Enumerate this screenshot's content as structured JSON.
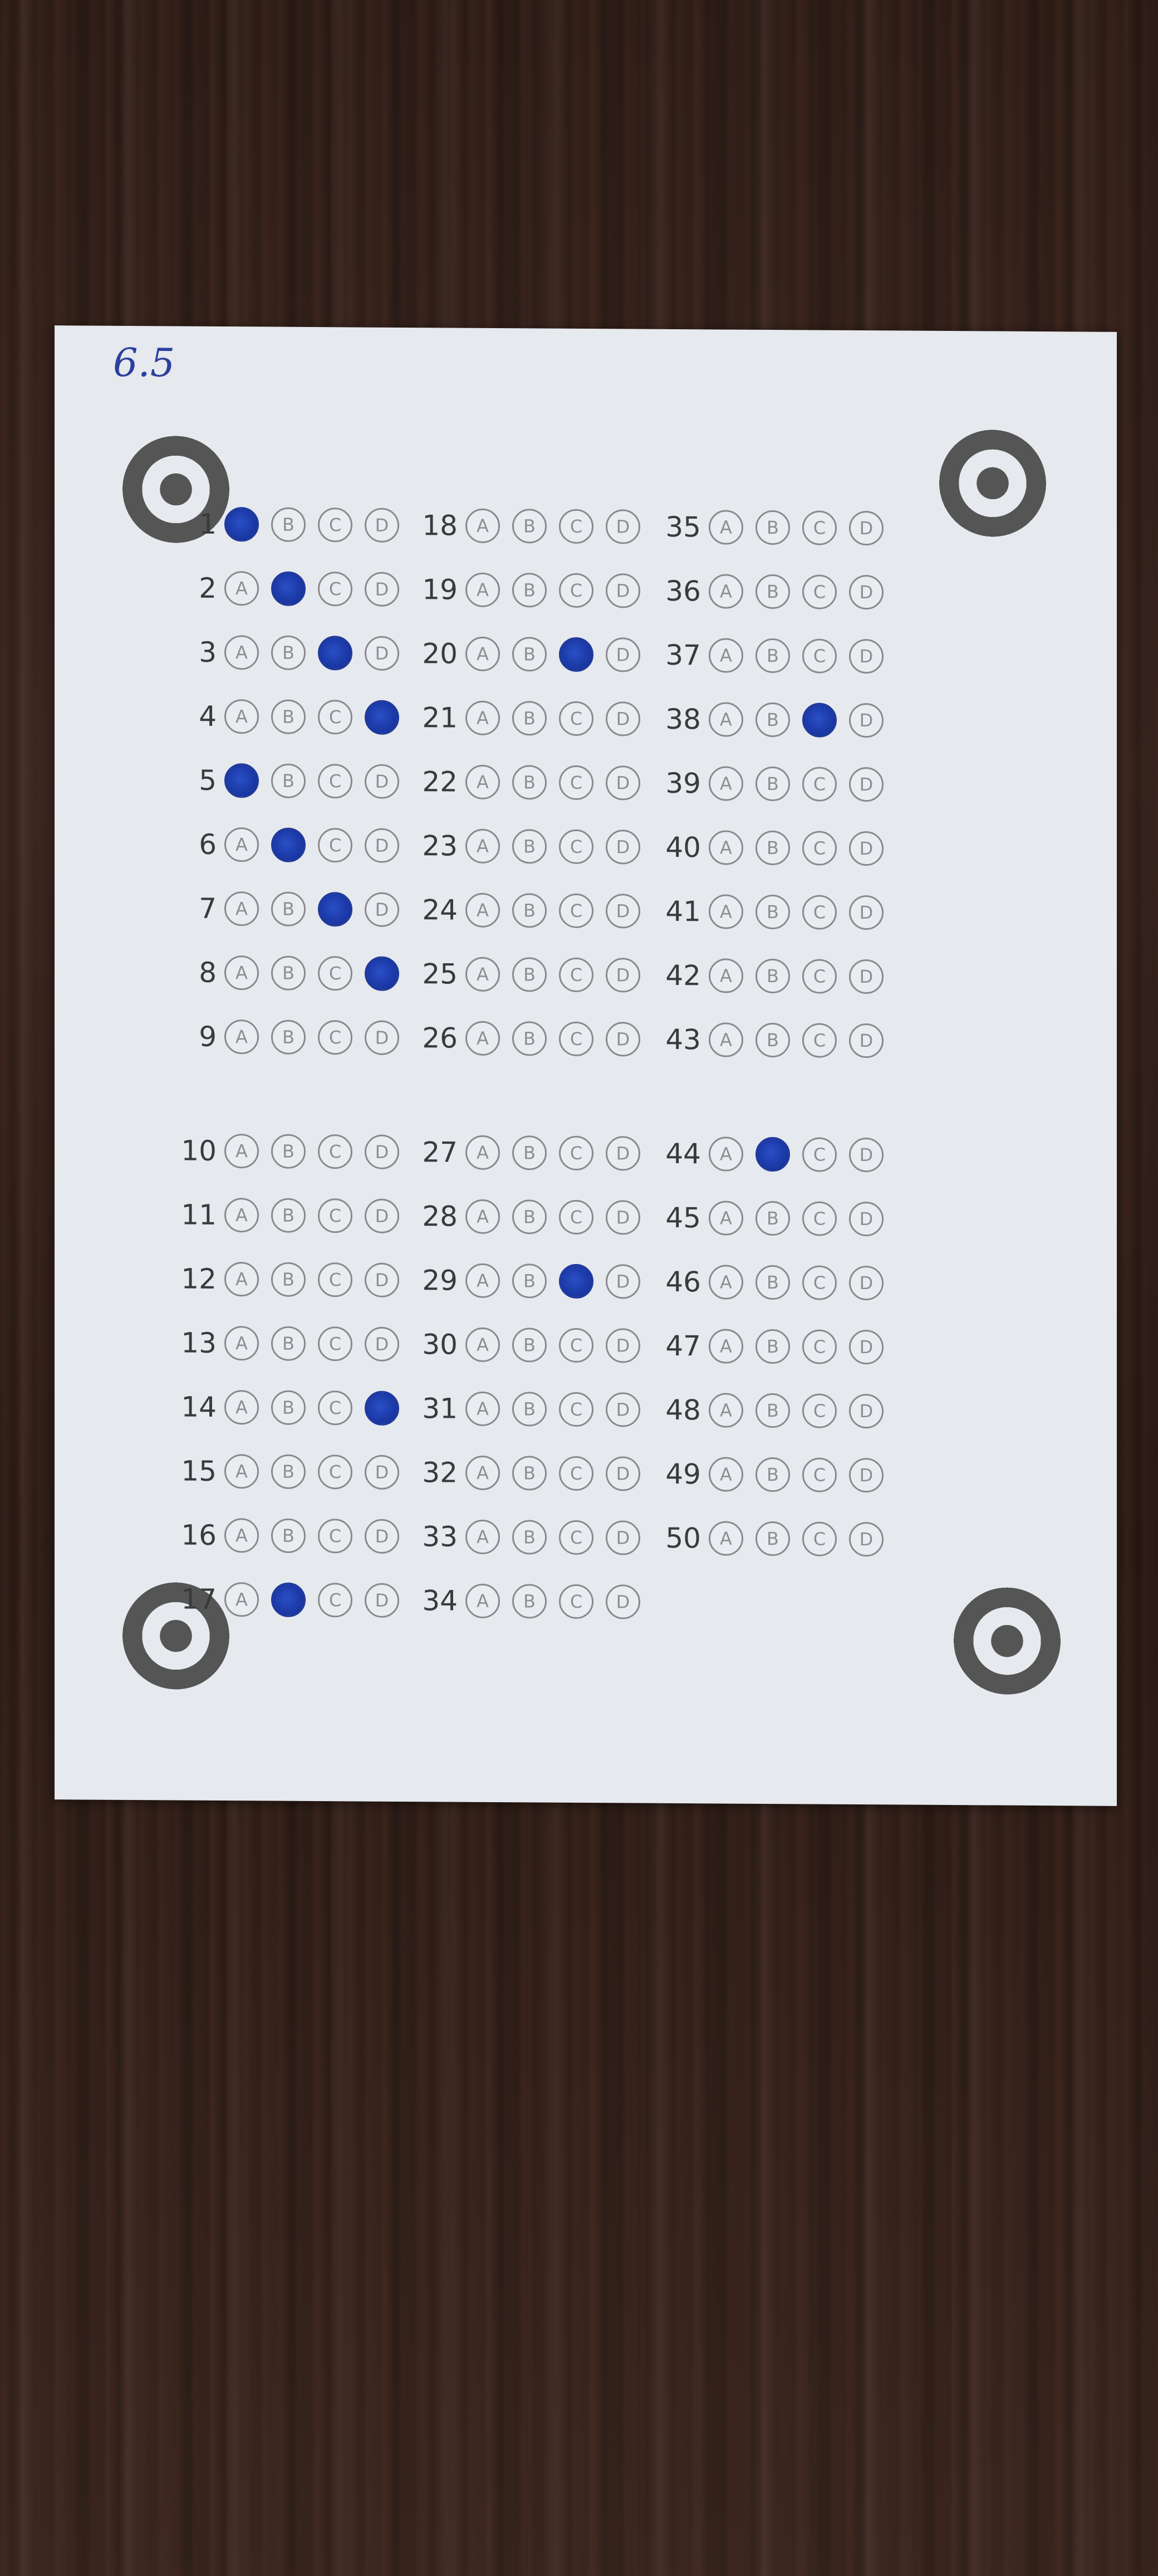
{
  "score_note": "6.5",
  "questions": [
    {
      "n": "1",
      "marked": "A"
    },
    {
      "n": "2",
      "marked": "B"
    },
    {
      "n": "3",
      "marked": "C"
    },
    {
      "n": "4",
      "marked": "D"
    },
    {
      "n": "5",
      "marked": "A"
    },
    {
      "n": "6",
      "marked": "B"
    },
    {
      "n": "7",
      "marked": "C"
    },
    {
      "n": "8",
      "marked": "D"
    },
    {
      "n": "9",
      "marked": ""
    },
    {
      "n": "10",
      "marked": ""
    },
    {
      "n": "11",
      "marked": ""
    },
    {
      "n": "12",
      "marked": ""
    },
    {
      "n": "13",
      "marked": ""
    },
    {
      "n": "14",
      "marked": "D"
    },
    {
      "n": "15",
      "marked": ""
    },
    {
      "n": "16",
      "marked": ""
    },
    {
      "n": "17",
      "marked": "B"
    },
    {
      "n": "18",
      "marked": ""
    },
    {
      "n": "19",
      "marked": ""
    },
    {
      "n": "20",
      "marked": "C"
    },
    {
      "n": "21",
      "marked": ""
    },
    {
      "n": "22",
      "marked": ""
    },
    {
      "n": "23",
      "marked": ""
    },
    {
      "n": "24",
      "marked": ""
    },
    {
      "n": "25",
      "marked": ""
    },
    {
      "n": "26",
      "marked": ""
    },
    {
      "n": "27",
      "marked": ""
    },
    {
      "n": "28",
      "marked": ""
    },
    {
      "n": "29",
      "marked": "C"
    },
    {
      "n": "30",
      "marked": ""
    },
    {
      "n": "31",
      "marked": ""
    },
    {
      "n": "32",
      "marked": ""
    },
    {
      "n": "33",
      "marked": ""
    },
    {
      "n": "34",
      "marked": ""
    },
    {
      "n": "35",
      "marked": ""
    },
    {
      "n": "36",
      "marked": ""
    },
    {
      "n": "37",
      "marked": ""
    },
    {
      "n": "38",
      "marked": "C"
    },
    {
      "n": "39",
      "marked": ""
    },
    {
      "n": "40",
      "marked": ""
    },
    {
      "n": "41",
      "marked": ""
    },
    {
      "n": "42",
      "marked": ""
    },
    {
      "n": "43",
      "marked": ""
    },
    {
      "n": "44",
      "marked": "B"
    },
    {
      "n": "45",
      "marked": ""
    },
    {
      "n": "46",
      "marked": ""
    },
    {
      "n": "47",
      "marked": ""
    },
    {
      "n": "48",
      "marked": ""
    },
    {
      "n": "49",
      "marked": ""
    },
    {
      "n": "50",
      "marked": ""
    }
  ],
  "options": [
    "A",
    "B",
    "C",
    "D"
  ]
}
